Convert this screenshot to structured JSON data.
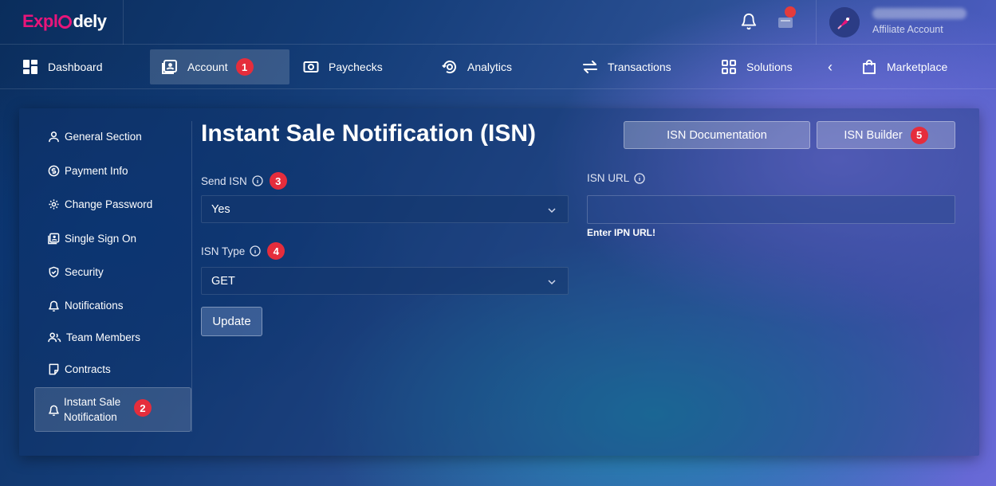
{
  "app": {
    "logo_left": "Expl",
    "logo_right": "dely",
    "user_role": "Affiliate Account"
  },
  "nav": {
    "items": [
      {
        "label": "Dashboard",
        "icon": "dashboard-grid-icon"
      },
      {
        "label": "Account",
        "icon": "account-card-icon",
        "badge": "1",
        "active": true
      },
      {
        "label": "Paychecks",
        "icon": "paycheck-icon"
      },
      {
        "label": "Analytics",
        "icon": "analytics-icon"
      },
      {
        "label": "Transactions",
        "icon": "transfer-arrows-icon"
      },
      {
        "label": "Solutions",
        "icon": "solutions-grid-icon"
      },
      {
        "label": "‹",
        "icon": "chevron-left-icon"
      },
      {
        "label": "Marketplace",
        "icon": "shopping-bag-icon"
      }
    ]
  },
  "sidebar": {
    "items": [
      {
        "label": "General Section",
        "icon": "user-icon"
      },
      {
        "label": "Payment Info",
        "icon": "dollar-circle-icon"
      },
      {
        "label": "Change Password",
        "icon": "gear-icon"
      },
      {
        "label": "Single Sign On",
        "icon": "id-card-icon"
      },
      {
        "label": "Security",
        "icon": "shield-icon"
      },
      {
        "label": "Notifications",
        "icon": "bell-icon"
      },
      {
        "label": "Team Members",
        "icon": "team-icon"
      },
      {
        "label": "Contracts",
        "icon": "contract-icon"
      },
      {
        "label": "Instant Sale Notification",
        "icon": "bell-icon",
        "badge": "2",
        "active": true
      }
    ]
  },
  "main": {
    "title": "Instant Sale Notification (ISN)",
    "buttons": {
      "documentation": "ISN Documentation",
      "builder": "ISN Builder",
      "builder_badge": "5",
      "update": "Update"
    },
    "send_isn": {
      "label": "Send ISN",
      "badge": "3",
      "value": "Yes"
    },
    "isn_type": {
      "label": "ISN Type",
      "badge": "4",
      "value": "GET"
    },
    "isn_url": {
      "label": "ISN URL",
      "value": "",
      "helper": "Enter IPN URL!"
    }
  },
  "colors": {
    "accent_pink": "#e8157a",
    "badge_red": "#e52d3c"
  }
}
